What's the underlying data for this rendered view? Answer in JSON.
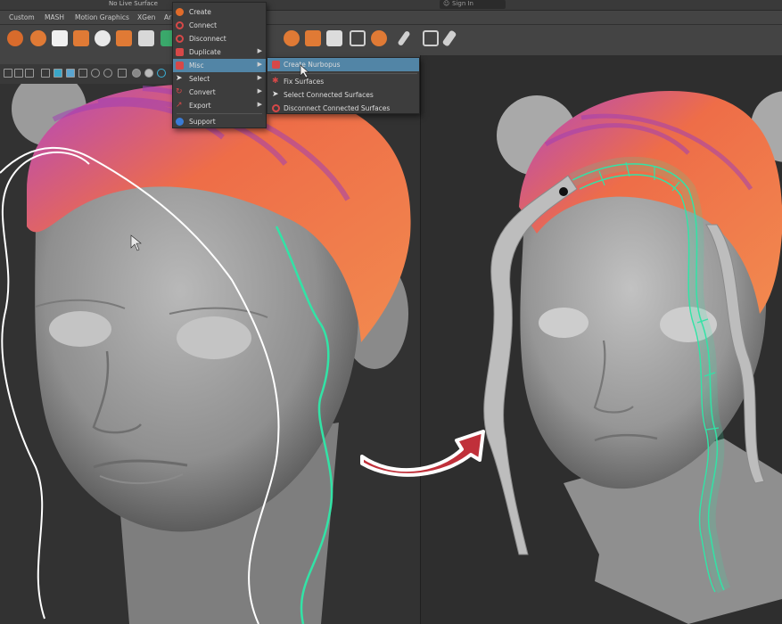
{
  "status": {
    "live_surface": "No Live Surface",
    "sign_in": "Sign In"
  },
  "shelf_tabs": [
    "Custom",
    "MASH",
    "Motion Graphics",
    "XGen",
    "Ar"
  ],
  "gs_menu": {
    "items": [
      {
        "label": "Create",
        "icon": "create-icon",
        "color": "#e06b2a",
        "submenu": false
      },
      {
        "label": "Connect",
        "icon": "connect-icon",
        "color": "#d64848",
        "submenu": false
      },
      {
        "label": "Disconnect",
        "icon": "disconnect-icon",
        "color": "#d64848",
        "submenu": false
      },
      {
        "label": "Duplicate",
        "icon": "duplicate-icon",
        "color": "#d64848",
        "submenu": true
      },
      {
        "label": "Misc",
        "icon": "misc-icon",
        "color": "#d64848",
        "submenu": true
      },
      {
        "label": "Select",
        "icon": "select-icon",
        "color": "#e0e0e0",
        "submenu": true
      },
      {
        "label": "Convert",
        "icon": "convert-icon",
        "color": "#d64848",
        "submenu": true
      },
      {
        "label": "Export",
        "icon": "export-icon",
        "color": "#d64848",
        "submenu": true
      },
      {
        "label": "Support",
        "icon": "support-icon",
        "color": "#3a7bd5",
        "submenu": false
      }
    ],
    "active": "Misc"
  },
  "misc_submenu": {
    "items": [
      {
        "label": "Create Nurbopus",
        "icon": "nurbopus-icon"
      },
      {
        "label": "Fix Surfaces",
        "icon": "fix-surfaces-icon"
      },
      {
        "label": "Select Connected Surfaces",
        "icon": "select-connected-icon"
      },
      {
        "label": "Disconnect Connected Surfaces",
        "icon": "disconnect-connected-icon"
      }
    ],
    "active": "Create Nurbopus"
  },
  "colors": {
    "accent": "#5285a6",
    "hair_orange": "#f07a45",
    "hair_purple": "#9a3fb3",
    "curve_green": "#32e3a6",
    "arrow_red": "#c0303a"
  }
}
